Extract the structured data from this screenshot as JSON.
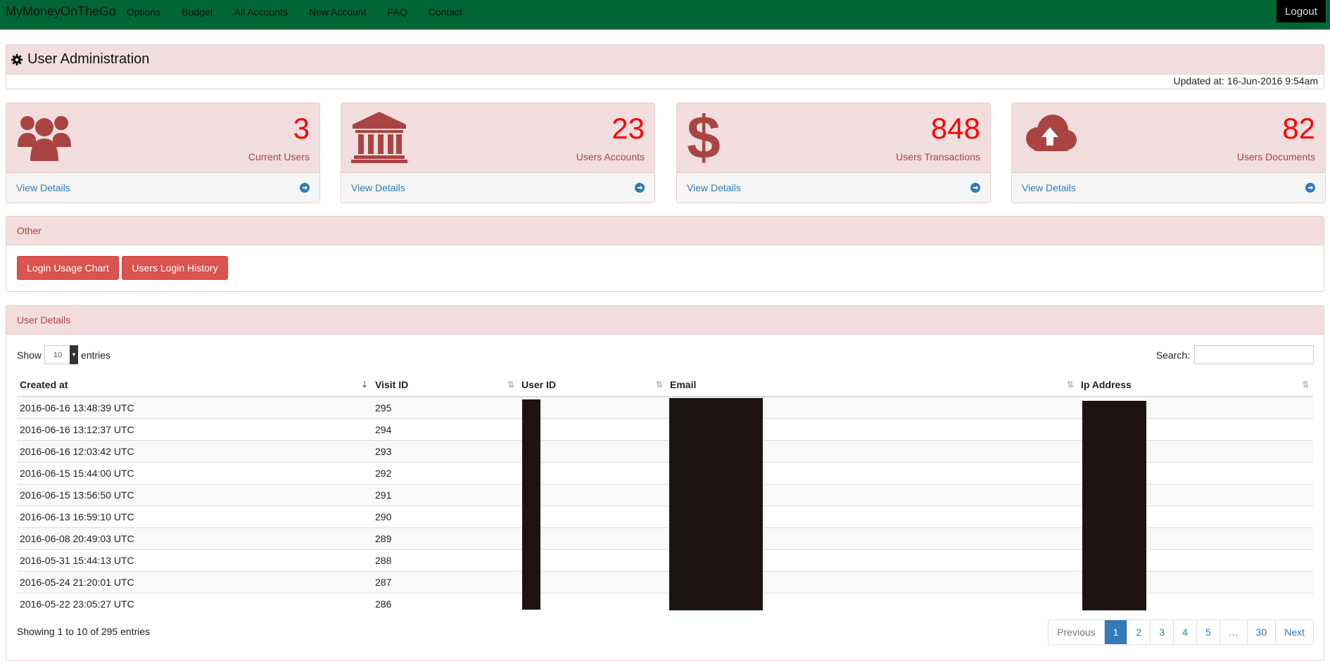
{
  "navbar": {
    "brand": "MyMoneyOnTheGo",
    "items": [
      "Options",
      "Budget",
      "All Accounts",
      "New Account",
      "FAQ",
      "Contact"
    ],
    "logout": "Logout",
    "bg_color": "#006633"
  },
  "header": {
    "title": "User Administration",
    "icon": "gear-icon",
    "updated": "Updated at: 16-Jun-2016 9:54am"
  },
  "stats": [
    {
      "icon": "users-icon",
      "value": "3",
      "label": "Current Users",
      "link": "View Details"
    },
    {
      "icon": "bank-icon",
      "value": "23",
      "label": "Users Accounts",
      "link": "View Details"
    },
    {
      "icon": "dollar-icon",
      "value": "848",
      "label": "Users Transactions",
      "link": "View Details"
    },
    {
      "icon": "cloud-upload-icon",
      "value": "82",
      "label": "Users Documents",
      "link": "View Details"
    }
  ],
  "other": {
    "heading": "Other",
    "buttons": [
      "Login Usage Chart",
      "Users Login History"
    ]
  },
  "details": {
    "heading": "User Details",
    "show_label": "Show",
    "entries_label": "entries",
    "page_length": "10",
    "search_label": "Search:",
    "columns": [
      "Created at",
      "Visit ID",
      "User ID",
      "Email",
      "Ip Address"
    ],
    "rows": [
      {
        "created": "2016-06-16 13:48:39 UTC",
        "visit": "295"
      },
      {
        "created": "2016-06-16 13:12:37 UTC",
        "visit": "294"
      },
      {
        "created": "2016-06-16 12:03:42 UTC",
        "visit": "293"
      },
      {
        "created": "2016-06-15 15:44:00 UTC",
        "visit": "292"
      },
      {
        "created": "2016-06-15 13:56:50 UTC",
        "visit": "291"
      },
      {
        "created": "2016-06-13 16:59:10 UTC",
        "visit": "290"
      },
      {
        "created": "2016-06-08 20:49:03 UTC",
        "visit": "289"
      },
      {
        "created": "2016-05-31 15:44:13 UTC",
        "visit": "288"
      },
      {
        "created": "2016-05-24 21:20:01 UTC",
        "visit": "287"
      },
      {
        "created": "2016-05-22 23:05:27 UTC",
        "visit": "286"
      }
    ],
    "info": "Showing 1 to 10 of 295 entries",
    "pagination": [
      "Previous",
      "1",
      "2",
      "3",
      "4",
      "5",
      "…",
      "30",
      "Next"
    ],
    "active_page": "1"
  }
}
